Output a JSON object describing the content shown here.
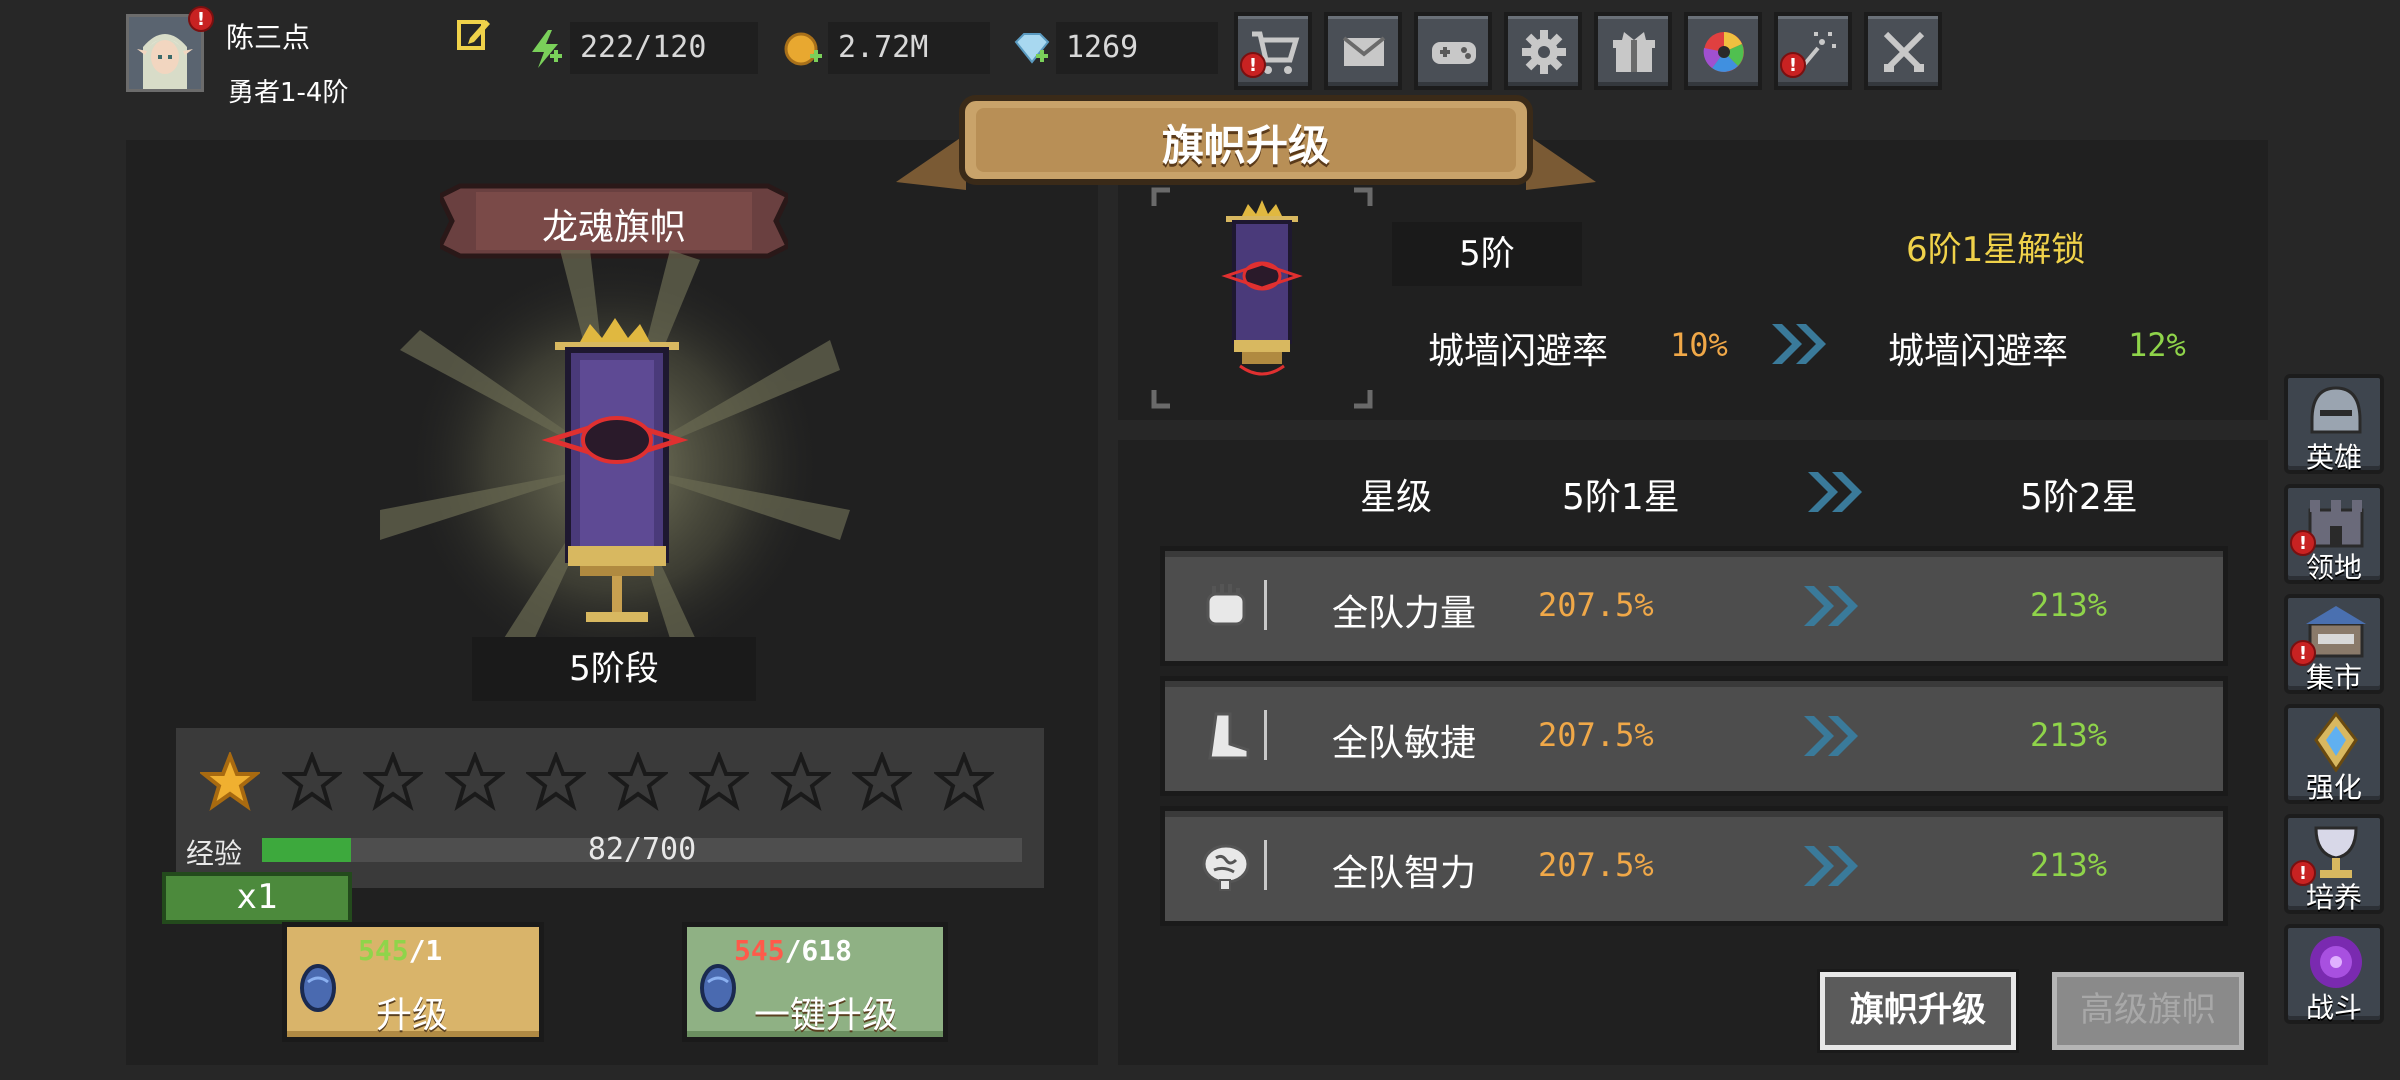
{
  "player": {
    "name": "陈三点",
    "rank": "勇者1-4阶"
  },
  "resources": {
    "stamina": "222/120",
    "gold": "2.72M",
    "gems": "1269"
  },
  "top_buttons": [
    "shop",
    "mail",
    "gamepad",
    "settings",
    "gift",
    "gacha",
    "fireworks",
    "battle"
  ],
  "page_title": "旗帜升级",
  "banner": {
    "name": "龙魂旗帜",
    "stage": "5阶段",
    "stars_filled": 1,
    "stars_total": 10,
    "exp_label": "经验",
    "exp_text": "82/700",
    "exp_current": 82,
    "exp_max": 700,
    "multiplier": "x1"
  },
  "upgrade_button": {
    "cost_have": "545",
    "cost_need": "/1",
    "label": "升级"
  },
  "oneclick_button": {
    "cost_have": "545",
    "cost_need": "/618",
    "label": "一键升级"
  },
  "tier": {
    "current": "5阶",
    "unlock_text": "6阶1星解锁",
    "stat_name_left": "城墙闪避率",
    "stat_val_left": "10%",
    "stat_name_right": "城墙闪避率",
    "stat_val_right": "12%"
  },
  "table": {
    "col_star": "星级",
    "col_from": "5阶1星",
    "col_to": "5阶2星",
    "rows": [
      {
        "icon": "fist-icon",
        "name": "全队力量",
        "from": "207.5%",
        "to": "213%"
      },
      {
        "icon": "boot-icon",
        "name": "全队敏捷",
        "from": "207.5%",
        "to": "213%"
      },
      {
        "icon": "brain-icon",
        "name": "全队智力",
        "from": "207.5%",
        "to": "213%"
      }
    ]
  },
  "bottom_buttons": {
    "banner_upgrade": "旗帜升级",
    "advanced_banner": "高级旗帜"
  },
  "sidebar": [
    {
      "label": "英雄",
      "icon": "helmet-icon",
      "alert": false
    },
    {
      "label": "领地",
      "icon": "castle-icon",
      "alert": true
    },
    {
      "label": "集市",
      "icon": "market-icon",
      "alert": true
    },
    {
      "label": "强化",
      "icon": "crystal-icon",
      "alert": false
    },
    {
      "label": "培养",
      "icon": "grail-icon",
      "alert": true
    },
    {
      "label": "战斗",
      "icon": "vortex-icon",
      "alert": false
    }
  ],
  "colors": {
    "background": "#272727",
    "panel": "#202020",
    "accent_orange": "#f0a848",
    "accent_green": "#8fd44a",
    "unlock_yellow": "#f0d24a",
    "cost_insufficient": "#ff5a4a",
    "cost_ok": "#8fd44a"
  }
}
